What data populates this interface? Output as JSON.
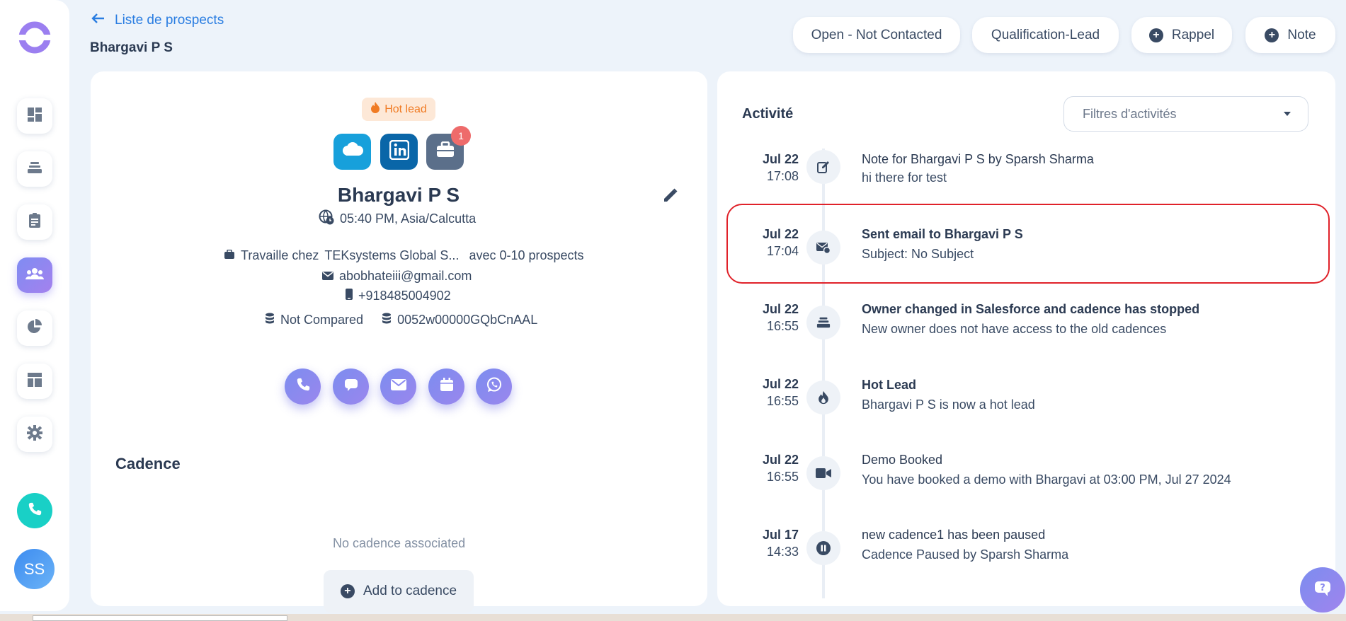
{
  "header": {
    "back_label": "Liste de prospects",
    "title": "Bhargavi P S",
    "status_button": "Open - Not Contacted",
    "stage_button": "Qualification-Lead",
    "reminder_button": "Rappel",
    "note_button": "Note"
  },
  "sidebar": {
    "items": [
      "dashboard-icon",
      "layers-icon",
      "clipboard-icon",
      "people-icon",
      "pie-chart-icon",
      "layout-icon",
      "gear-icon"
    ],
    "active_item": "people-icon",
    "avatar_initials": "SS"
  },
  "prospect": {
    "badge": "Hot lead",
    "notification_count": "1",
    "name": "Bhargavi P S",
    "local_time": "05:40 PM, Asia/Calcutta",
    "works_at_prefix": "Travaille chez",
    "company": "TEKsystems Global S...",
    "company_suffix": "avec 0-10 prospects",
    "email": "abobhateiii@gmail.com",
    "phone": "+918485004902",
    "compare_status": "Not Compared",
    "salesforce_id": "0052w00000GQbCnAAL"
  },
  "cadence": {
    "title": "Cadence",
    "empty_text": "No cadence associated",
    "add_button": "Add to cadence"
  },
  "activity": {
    "title": "Activité",
    "filter_placeholder": "Filtres d'activités",
    "items": [
      {
        "date": "Jul 22",
        "time": "17:08",
        "icon": "edit-note-icon",
        "heading": "Note for Bhargavi P S by Sparsh Sharma",
        "detail": "hi there for test"
      },
      {
        "date": "Jul 22",
        "time": "17:04",
        "icon": "email-sent-icon",
        "heading": "Sent email to Bhargavi P S",
        "detail": "Subject: No Subject"
      },
      {
        "date": "Jul 22",
        "time": "16:55",
        "icon": "layers-icon",
        "heading": "Owner changed in Salesforce and cadence has stopped",
        "detail": "New owner does not have access to the old cadences"
      },
      {
        "date": "Jul 22",
        "time": "16:55",
        "icon": "fire-icon",
        "heading": "Hot Lead",
        "detail": "Bhargavi P S is now a hot lead"
      },
      {
        "date": "Jul 22",
        "time": "16:55",
        "icon": "video-icon",
        "heading": "Demo Booked",
        "detail": "You have booked a demo with Bhargavi at 03:00 PM, Jul 27 2024"
      },
      {
        "date": "Jul 17",
        "time": "14:33",
        "icon": "pause-icon",
        "heading": "new cadence1 has been paused",
        "detail": "Cadence Paused by Sparsh Sharma"
      }
    ]
  },
  "colors": {
    "accent_blue": "#2a7de1",
    "hot_orange": "#f07b24",
    "action_purple": "#8a8af0",
    "highlight_red": "#e0222a"
  }
}
